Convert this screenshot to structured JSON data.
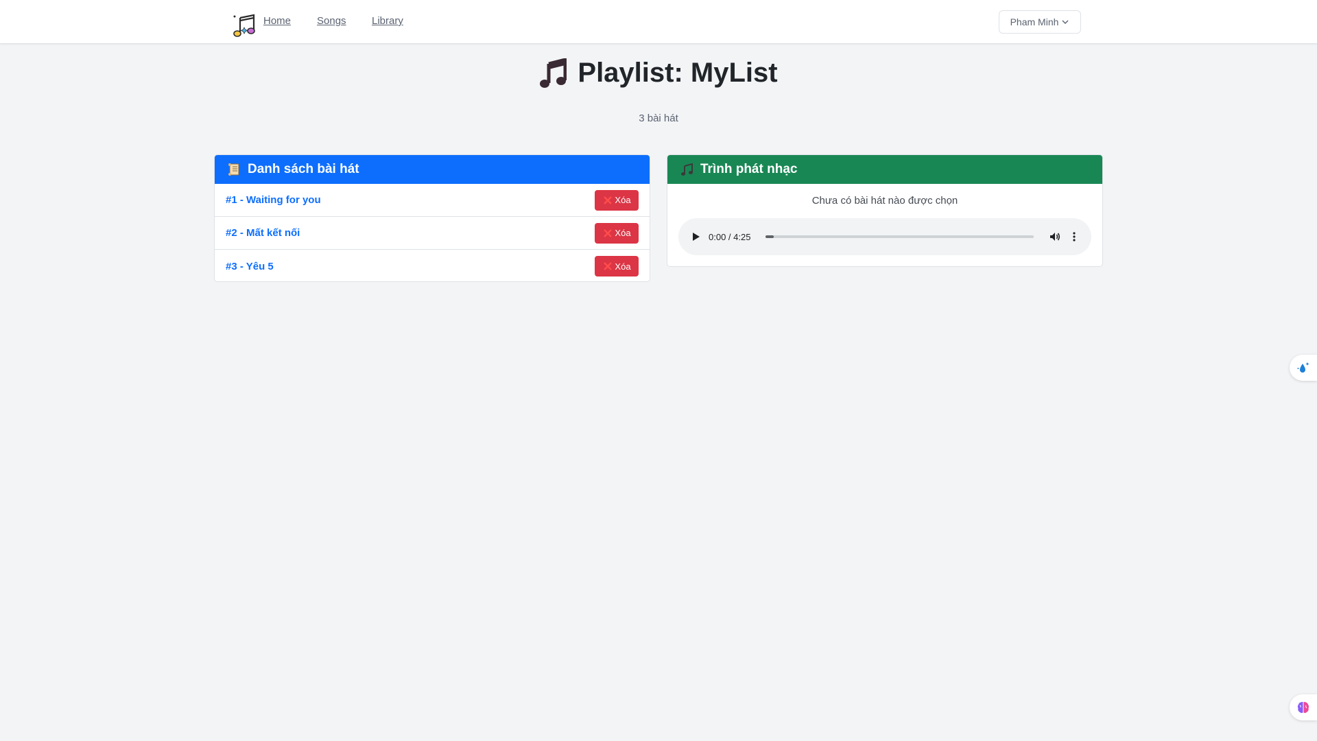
{
  "nav": {
    "links": [
      "Home",
      "Songs",
      "Library"
    ],
    "user_name": "Pham Minh"
  },
  "header": {
    "title": "Playlist: MyList",
    "song_count": "3 bài hát"
  },
  "song_list": {
    "header": "Danh sách bài hát",
    "delete_label": "Xóa",
    "songs": [
      "#1 - Waiting for you",
      "#2 - Mất kết nối",
      "#3 - Yêu 5"
    ]
  },
  "player": {
    "header": "Trình phát nhạc",
    "empty_text": "Chưa có bài hát nào được chọn",
    "time": "0:00 / 4:25",
    "progress": 0.03
  },
  "colors": {
    "primary": "#0d6efd",
    "success": "#198754",
    "danger": "#dc3545",
    "background": "#f3f4f6"
  }
}
